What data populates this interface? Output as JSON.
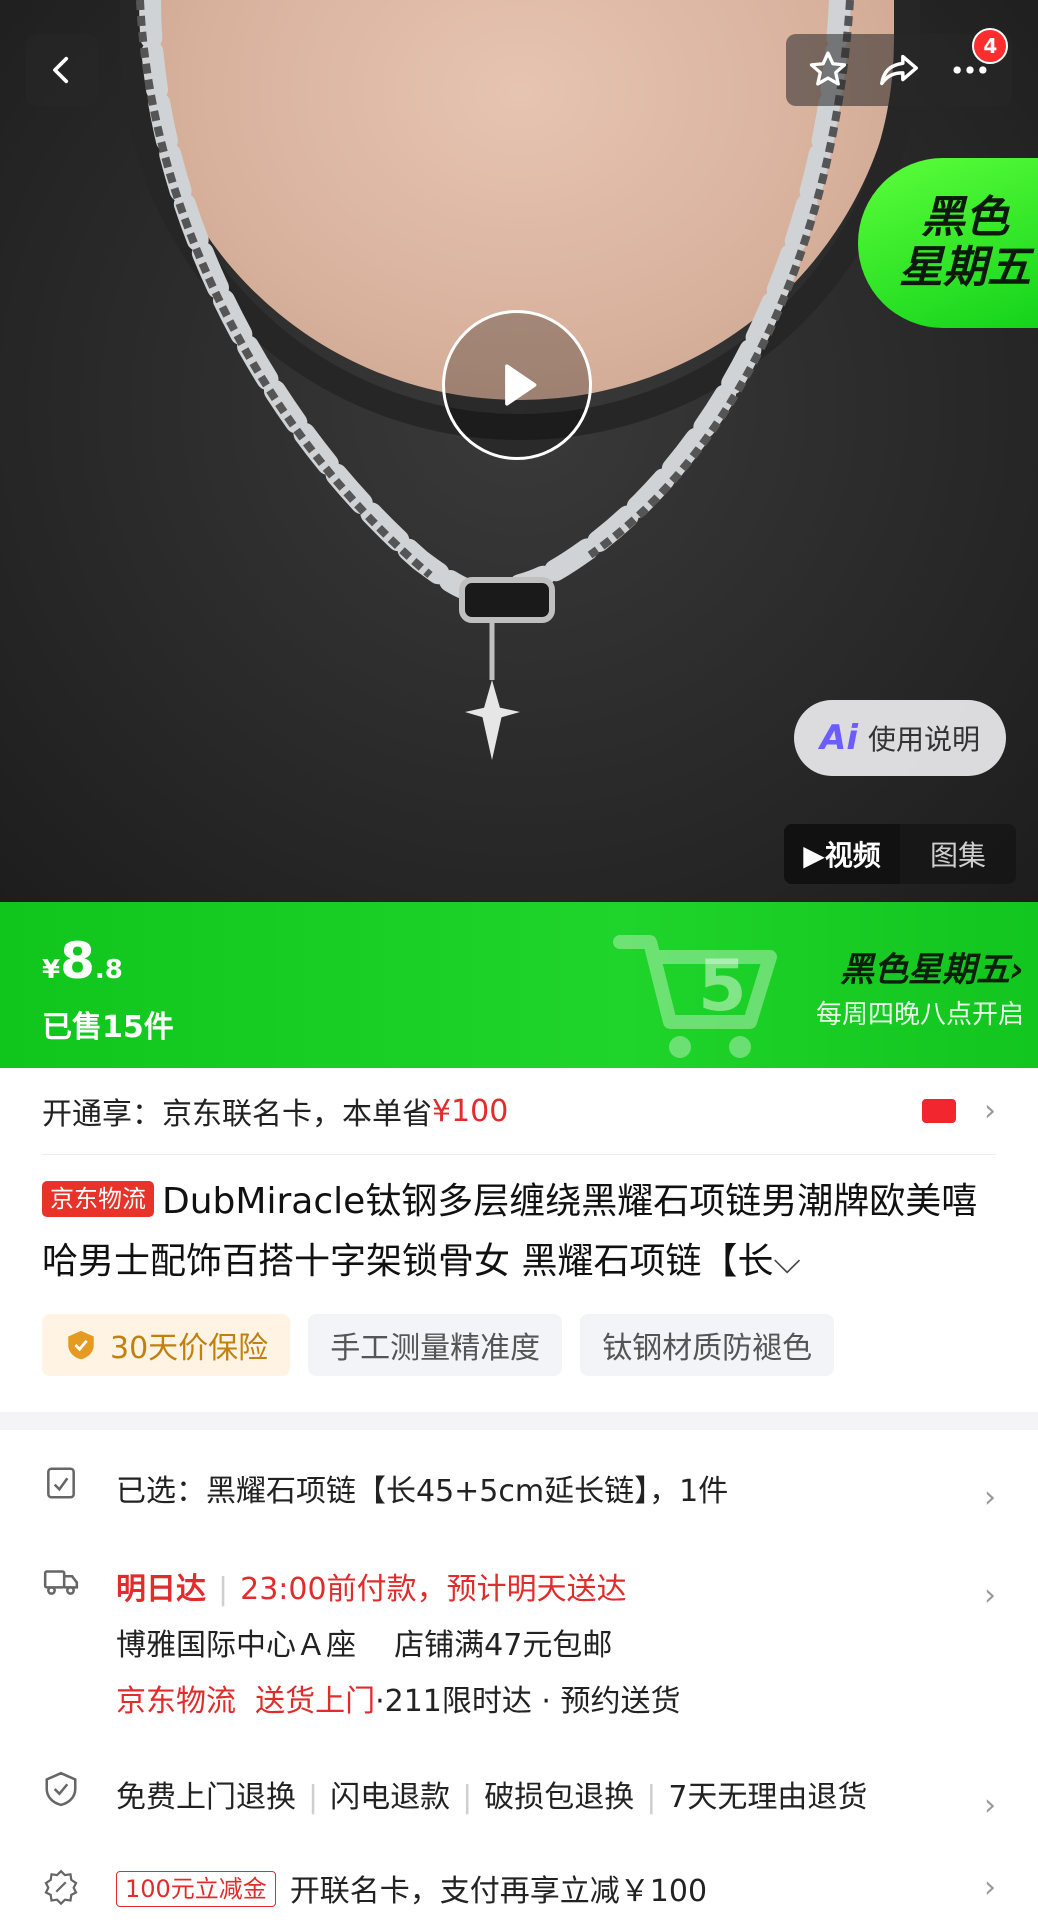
{
  "nav": {
    "cart_badge": "4"
  },
  "promo_badge": {
    "line1": "黑色",
    "line2": "星期五"
  },
  "ai_pill": {
    "mark": "Ai",
    "label": "使用说明"
  },
  "media_toggle": {
    "video": "▶视频",
    "gallery": "图集"
  },
  "price_bar": {
    "currency": "¥",
    "price_int": "8",
    "price_dec": ".8",
    "sold": "已售15件",
    "event_title": "黑色星期五",
    "event_sub": "每周四晚八点开启",
    "event_chevron": "›"
  },
  "card_offer": {
    "prefix": "开通享：京东联名卡，本单省",
    "amount": "¥100"
  },
  "product": {
    "logistics_tag": "京东物流",
    "title": "DubMiracle钛钢多层缠绕黑耀石项链男潮牌欧美嘻哈男士配饰百搭十字架锁骨女 黑耀石项链【长",
    "expand": "⌵"
  },
  "chips": [
    "30天价保险",
    "手工测量精准度",
    "钛钢材质防褪色"
  ],
  "selected": {
    "label": "已选：",
    "value": "黑耀石项链【长45+5cm延长链】，1件"
  },
  "delivery": {
    "speed": "明日达",
    "promise": "23:00前付款，预计明天送达",
    "address": "博雅国际中心Ａ座",
    "shipping": "店铺满47元包邮",
    "carrier": "京东物流",
    "door": "送货上门",
    "options": "·211限时达 · 预约送货"
  },
  "services": [
    "免费上门退换",
    "闪电退款",
    "破损包退换",
    "7天无理由退货"
  ],
  "coupon": {
    "tag": "100元立减金",
    "text": "开联名卡，支付再享立减￥100"
  },
  "chevron": "›",
  "colors": {
    "brand_green": "#12c51f",
    "accent_red": "#e22b2b",
    "gold": "#c2800f"
  }
}
